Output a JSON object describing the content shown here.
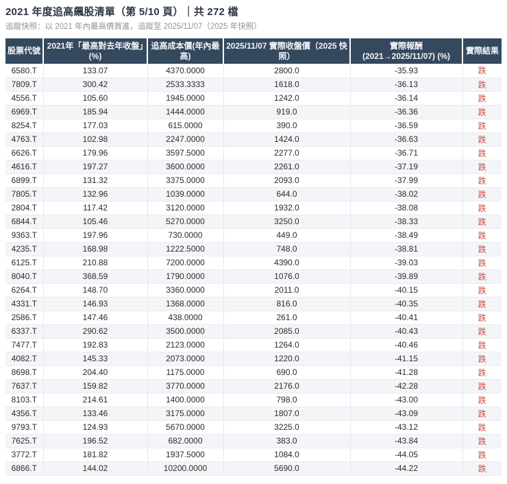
{
  "page": {
    "title": "2021 年度追高飆股清單（第 5/10 頁）｜共 272 檔",
    "subtitle": "追蹤快照：以 2021 年內最高價買進，追蹤至 2025/11/07（2025 年快照）"
  },
  "colors": {
    "header_bg": "#34495e",
    "result_red": "#cd4a42",
    "zebra_stripe": "#f3f5f8"
  },
  "table": {
    "columns": [
      {
        "key": "code",
        "label": "股票代號"
      },
      {
        "key": "pct",
        "label": "2021年「最高對去年收盤」(%)"
      },
      {
        "key": "cost",
        "label": "追高成本價(年內最高)"
      },
      {
        "key": "close",
        "label": "2025/11/07 實際收盤價（2025 快照）"
      },
      {
        "key": "return",
        "label": "實際報酬\n(2021→2025/11/07) (%)"
      },
      {
        "key": "result",
        "label": "實際結果"
      }
    ],
    "rows": [
      [
        "6580.T",
        "133.07",
        "4370.0000",
        "2800.0",
        "-35.93",
        "跌"
      ],
      [
        "7809.T",
        "300.42",
        "2533.3333",
        "1618.0",
        "-36.13",
        "跌"
      ],
      [
        "4556.T",
        "105.60",
        "1945.0000",
        "1242.0",
        "-36.14",
        "跌"
      ],
      [
        "6969.T",
        "185.94",
        "1444.0000",
        "919.0",
        "-36.36",
        "跌"
      ],
      [
        "8254.T",
        "177.03",
        "615.0000",
        "390.0",
        "-36.59",
        "跌"
      ],
      [
        "4763.T",
        "102.98",
        "2247.0000",
        "1424.0",
        "-36.63",
        "跌"
      ],
      [
        "6626.T",
        "179.96",
        "3597.5000",
        "2277.0",
        "-36.71",
        "跌"
      ],
      [
        "4616.T",
        "197.27",
        "3600.0000",
        "2261.0",
        "-37.19",
        "跌"
      ],
      [
        "6899.T",
        "131.32",
        "3375.0000",
        "2093.0",
        "-37.99",
        "跌"
      ],
      [
        "7805.T",
        "132.96",
        "1039.0000",
        "644.0",
        "-38.02",
        "跌"
      ],
      [
        "2804.T",
        "117.42",
        "3120.0000",
        "1932.0",
        "-38.08",
        "跌"
      ],
      [
        "6844.T",
        "105.46",
        "5270.0000",
        "3250.0",
        "-38.33",
        "跌"
      ],
      [
        "9363.T",
        "197.96",
        "730.0000",
        "449.0",
        "-38.49",
        "跌"
      ],
      [
        "4235.T",
        "168.98",
        "1222.5000",
        "748.0",
        "-38.81",
        "跌"
      ],
      [
        "6125.T",
        "210.88",
        "7200.0000",
        "4390.0",
        "-39.03",
        "跌"
      ],
      [
        "8040.T",
        "368.59",
        "1790.0000",
        "1076.0",
        "-39.89",
        "跌"
      ],
      [
        "6264.T",
        "148.70",
        "3360.0000",
        "2011.0",
        "-40.15",
        "跌"
      ],
      [
        "4331.T",
        "146.93",
        "1368.0000",
        "816.0",
        "-40.35",
        "跌"
      ],
      [
        "2586.T",
        "147.46",
        "438.0000",
        "261.0",
        "-40.41",
        "跌"
      ],
      [
        "6337.T",
        "290.62",
        "3500.0000",
        "2085.0",
        "-40.43",
        "跌"
      ],
      [
        "7477.T",
        "192.83",
        "2123.0000",
        "1264.0",
        "-40.46",
        "跌"
      ],
      [
        "4082.T",
        "145.33",
        "2073.0000",
        "1220.0",
        "-41.15",
        "跌"
      ],
      [
        "8698.T",
        "204.40",
        "1175.0000",
        "690.0",
        "-41.28",
        "跌"
      ],
      [
        "7637.T",
        "159.82",
        "3770.0000",
        "2176.0",
        "-42.28",
        "跌"
      ],
      [
        "8103.T",
        "214.61",
        "1400.0000",
        "798.0",
        "-43.00",
        "跌"
      ],
      [
        "4356.T",
        "133.46",
        "3175.0000",
        "1807.0",
        "-43.09",
        "跌"
      ],
      [
        "9793.T",
        "124.93",
        "5670.0000",
        "3225.0",
        "-43.12",
        "跌"
      ],
      [
        "7625.T",
        "196.52",
        "682.0000",
        "383.0",
        "-43.84",
        "跌"
      ],
      [
        "3772.T",
        "181.82",
        "1937.5000",
        "1084.0",
        "-44.05",
        "跌"
      ],
      [
        "6866.T",
        "144.02",
        "10200.0000",
        "5690.0",
        "-44.22",
        "跌"
      ]
    ]
  }
}
